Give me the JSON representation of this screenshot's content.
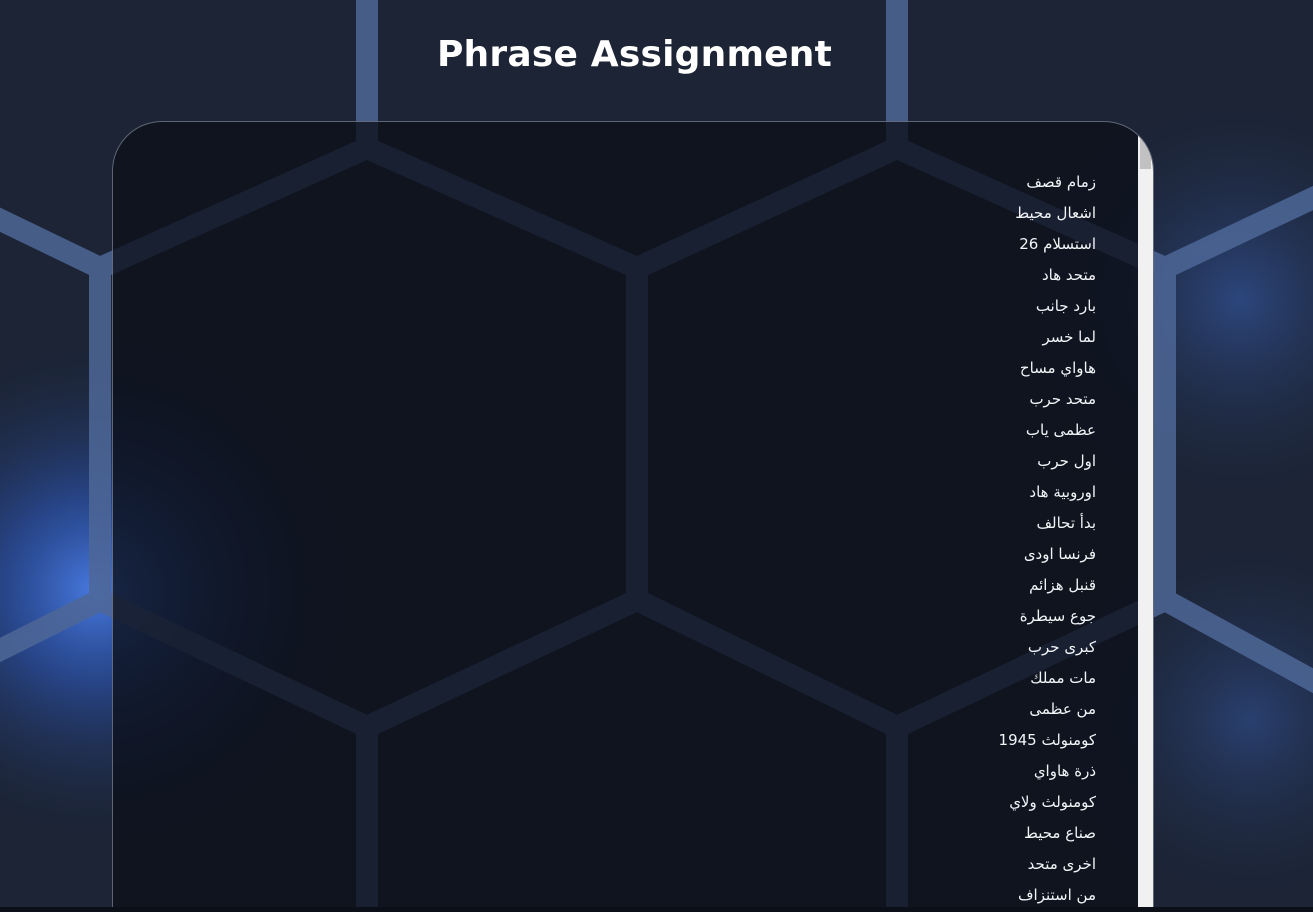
{
  "page": {
    "title": "Phrase Assignment"
  },
  "phrases": [
    "زمام قصف",
    "اشعال محيط",
    "استسلام 26",
    "متحد هاد",
    "بارد جانب",
    "لما خسر",
    "هاواي مساح",
    "متحد حرب",
    "عظمى ياب",
    "اول حرب",
    "اوروبية هاد",
    "بدأ تحالف",
    "فرنسا اودى",
    "قنبل هزائم",
    "جوع سيطرة",
    "كبرى حرب",
    "مات مملك",
    "من عظمى",
    "كومنولث 1945",
    "ذرة هاواي",
    "كومنولث ولاي",
    "صناع محيط",
    "اخرى متحد",
    "من استنزاف"
  ],
  "colors": {
    "background": "#1b2436",
    "panel": "#0b101a",
    "hex_edge": "#4f6a9e",
    "glow": "#3d6bd6",
    "text": "#f2f4f7"
  }
}
